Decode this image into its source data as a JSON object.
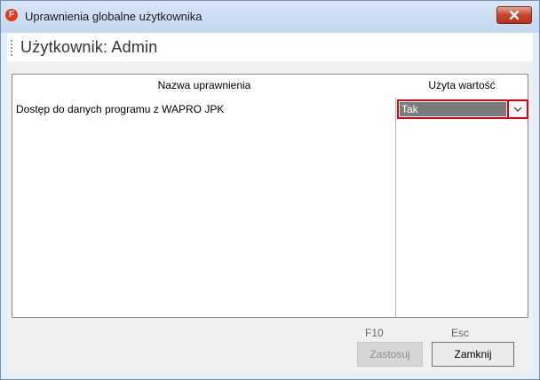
{
  "window": {
    "title": "Uprawnienia globalne użytkownika",
    "app_icon_letter": "F"
  },
  "header": {
    "user_label": "Użytkownik: Admin"
  },
  "grid": {
    "columns": [
      "Nazwa uprawnienia",
      "Użyta wartość"
    ],
    "rows": [
      {
        "name": "Dostęp do danych programu z WAPRO JPK",
        "value": "Tak"
      }
    ]
  },
  "buttons": {
    "apply": {
      "key": "F10",
      "label": "Zastosuj",
      "enabled": false
    },
    "close": {
      "key": "Esc",
      "label": "Zamknij",
      "enabled": true
    }
  },
  "colors": {
    "highlight": "#e00012",
    "selection": "#7b7b7b",
    "title_bar": "#c3d7f0"
  }
}
